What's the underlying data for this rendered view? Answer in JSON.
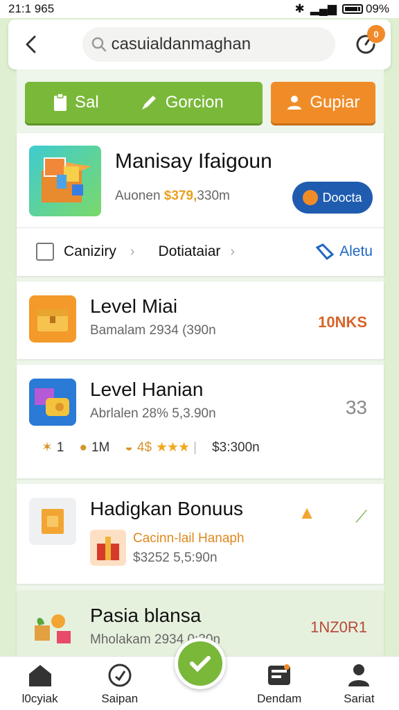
{
  "status_bar": {
    "time": "21:1 965",
    "battery_text": "09%"
  },
  "header": {
    "search_text": "casuialdanmaghan",
    "badge": "0"
  },
  "actions": {
    "sal_label": "Sal",
    "cercion_label": "Gorcion",
    "cupiar_label": "Gupiar"
  },
  "feature": {
    "title": "Manisay Ifaigoun",
    "sub_prefix": "Auonen",
    "sub_accent": "$379,",
    "sub_suffix": "330m",
    "button_label": "Doocta",
    "crumbs": {
      "first": "Caniziry",
      "second": "Dotiataiar",
      "link": "Aletu"
    }
  },
  "list": [
    {
      "title": "Level Miai",
      "sub": "Bamalam 2934 (390n",
      "right": "10NKS"
    },
    {
      "title": "Level Hanian",
      "sub": "Abrlalen 28% 5,3.90n",
      "right": "33",
      "stats": {
        "stars_count": "1",
        "coins": "1M",
        "rating_prefix": "4$",
        "stars": "★★★",
        "value": "$3:300n"
      }
    },
    {
      "title": "Hadigkan Bonuus",
      "sub1": "Cacinn-lail Hanaph",
      "sub2": "$3252 5,5:90n"
    },
    {
      "title": "Pasia blansa",
      "sub": "Mholakam 2934 0:30n",
      "right": "1NZ0R1"
    }
  ],
  "bottom_nav": [
    {
      "label": "l0cyiak"
    },
    {
      "label": "Saipan"
    },
    {
      "label": "Dendam"
    },
    {
      "label": "Sariat"
    }
  ],
  "colors": {
    "green": "#7ab83a",
    "orange": "#f08c28",
    "blue": "#1f5cb0",
    "bg": "#dff0d2"
  }
}
